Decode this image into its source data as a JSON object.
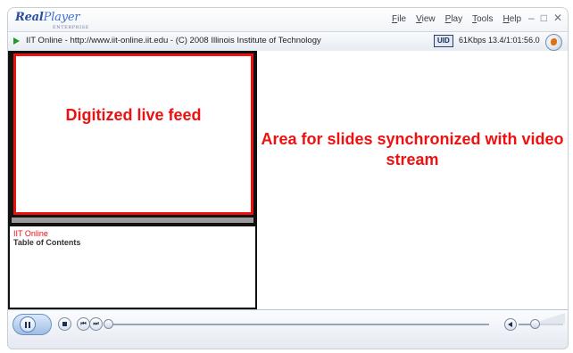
{
  "app": {
    "logo_main": "Real",
    "logo_sub": "Player",
    "logo_edition": "ENTERPRISE"
  },
  "menu": {
    "items": [
      "File",
      "View",
      "Play",
      "Tools",
      "Help"
    ]
  },
  "window_controls": {
    "minimize": "–",
    "maximize": "□",
    "close": "✕"
  },
  "status": {
    "clip_info": "IIT Online - http://www.iit-online.iit.edu - (C) 2008 Illinois Institute of Technology",
    "badge": "UID",
    "stream_info": "61Kbps 13.4/1:01:56.0"
  },
  "panes": {
    "video_label": "Digitized live feed",
    "slides_label": "Area for slides synchronized with video stream"
  },
  "toc": {
    "title": "IIT Online",
    "subtitle": "Table of Contents"
  },
  "controls": {
    "prev_label": "⏮",
    "next_label": "⏭"
  },
  "playback": {
    "seek_fraction": 0.0,
    "volume_fraction": 0.35
  },
  "colors": {
    "annotation_red": "#ee1111",
    "play_green": "#1f9a2e",
    "brand_blue": "#2a4fa0"
  },
  "icons": {
    "play_status": "play-triangle-icon",
    "globe": "globe-icon",
    "pause": "pause-icon",
    "stop": "stop-icon",
    "prev": "previous-icon",
    "next": "next-icon",
    "volume": "volume-icon"
  }
}
